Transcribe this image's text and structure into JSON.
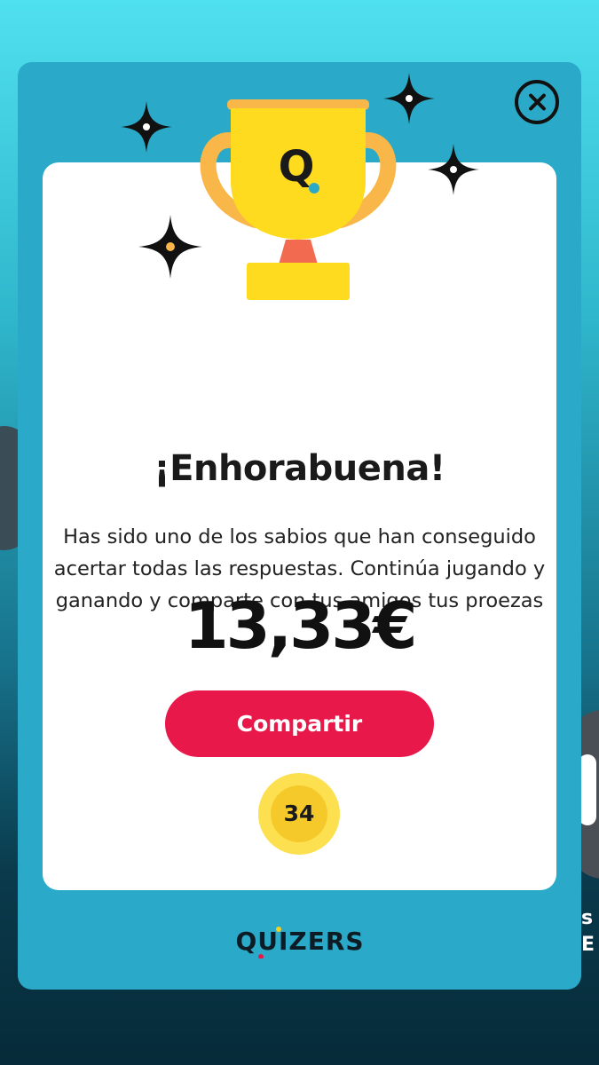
{
  "dialog": {
    "title": "¡Enhorabuena!",
    "message": "Has sido uno de los sabios que han conseguido acertar todas las respuestas. Continúa jugando y ganando y comparte con tus amigos tus proezas",
    "amount": "13,33€",
    "share_label": "Compartir",
    "coin_count": "34",
    "close_icon": "close-icon",
    "trophy_icon": "trophy-icon",
    "trophy_logo_letter": "Q"
  },
  "brand": {
    "name": "QUIZERS"
  },
  "background": {
    "side_text_line1": "s",
    "side_text_line2": "E"
  },
  "colors": {
    "modal_bg": "#2aaac8",
    "card_bg": "#ffffff",
    "button": "#e8194a",
    "trophy_gold": "#fedb1f",
    "trophy_handle": "#f9b74a",
    "coin_outer": "#fde04f",
    "coin_inner": "#f6c92a"
  }
}
